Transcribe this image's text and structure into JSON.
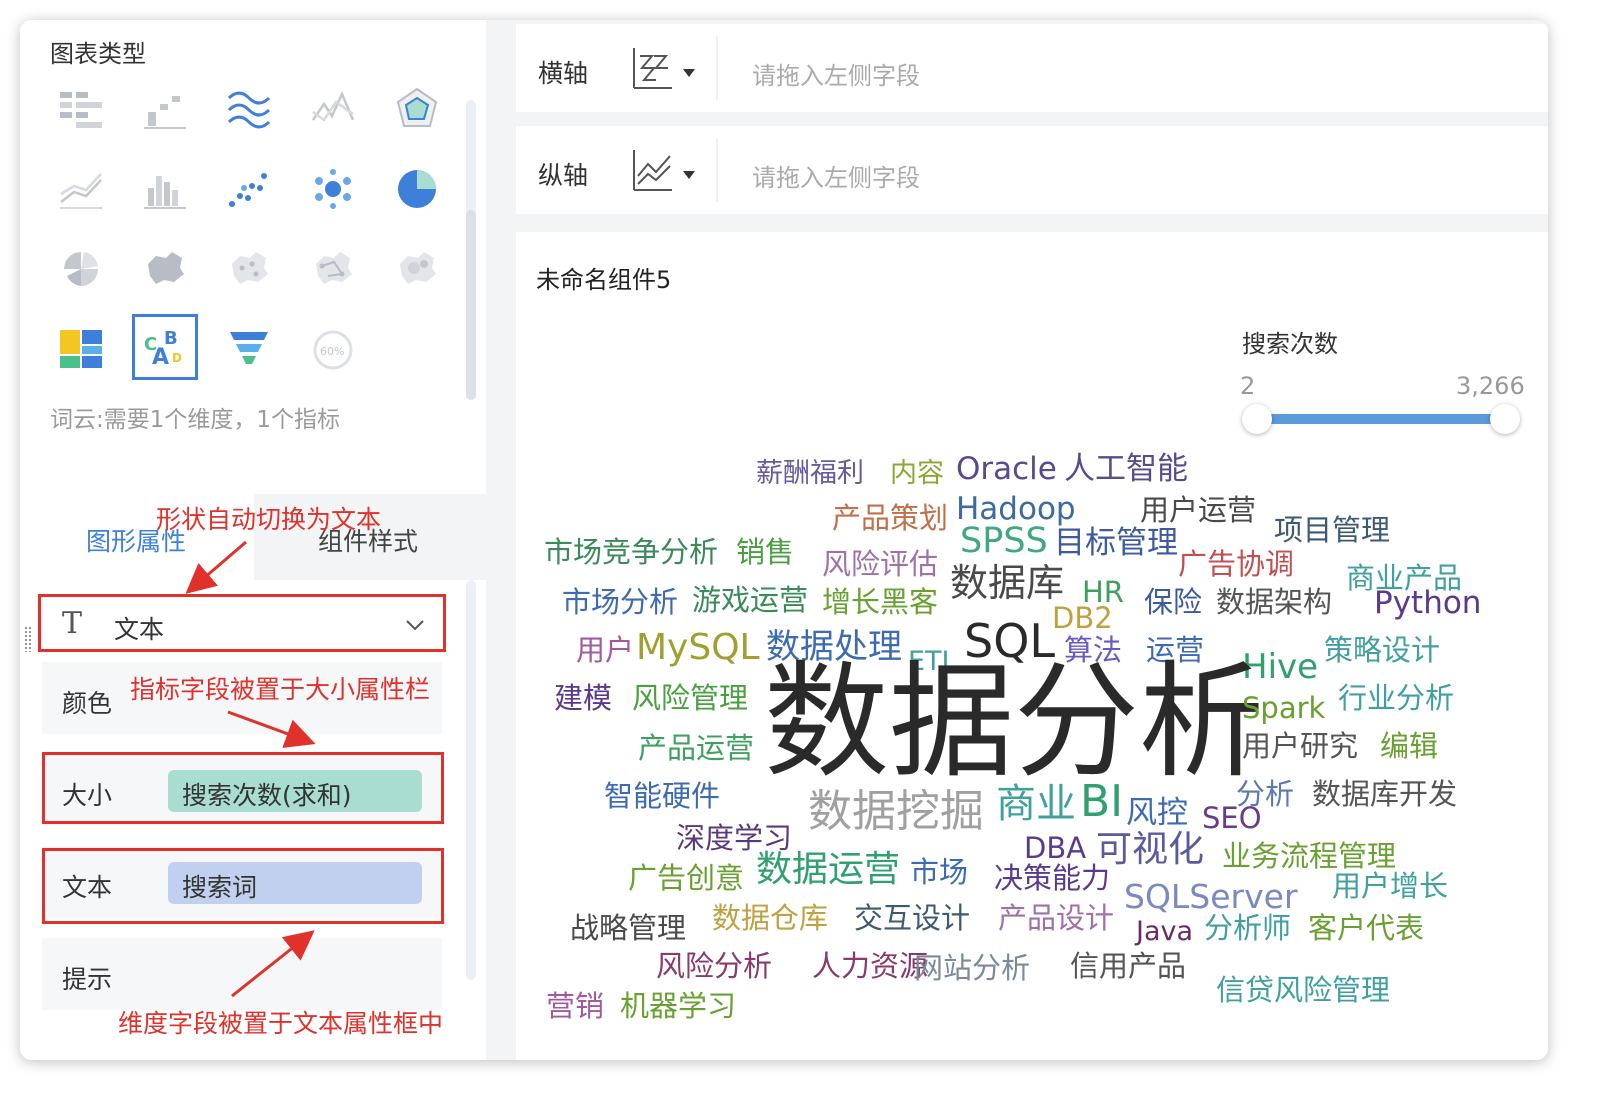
{
  "left_panel": {
    "chart_types_title": "图表类型",
    "selected_type": "word-cloud",
    "hint": "词云:需要1个维度，1个指标",
    "tabs": {
      "graphic": "图形属性",
      "style": "组件样式"
    },
    "shape_select": {
      "value": "文本"
    },
    "props": {
      "color_label": "颜色",
      "size_label": "大小",
      "size_field": "搜索次数(求和)",
      "text_label": "文本",
      "text_field": "搜索词",
      "tip_label": "提示"
    },
    "annotations": {
      "shape_note": "形状自动切换为文本",
      "size_note": "指标字段被置于大小属性栏",
      "text_note": "维度字段被置于文本属性框中"
    }
  },
  "axes": {
    "x_label": "横轴",
    "y_label": "纵轴",
    "placeholder": "请拖入左侧字段"
  },
  "widget": {
    "title": "未命名组件5",
    "legend_title": "搜索次数",
    "legend_min": "2",
    "legend_max": "3,266"
  },
  "chart_data": {
    "type": "word-cloud",
    "words": [
      {
        "text": "薪酬福利",
        "color": "#6a5a9c"
      },
      {
        "text": "内容",
        "color": "#8aa832"
      },
      {
        "text": "Oracle",
        "color": "#5a4a8c"
      },
      {
        "text": "人工智能",
        "color": "#5a4a8c"
      },
      {
        "text": "产品策划",
        "color": "#c0704a"
      },
      {
        "text": "Hadoop",
        "color": "#3d6aa0"
      },
      {
        "text": "用户运营",
        "color": "#4a4a4a"
      },
      {
        "text": "项目管理",
        "color": "#3d5a70"
      },
      {
        "text": "市场竞争分析",
        "color": "#3a8a5a"
      },
      {
        "text": "销售",
        "color": "#4aa040"
      },
      {
        "text": "风险评估",
        "color": "#a070a8"
      },
      {
        "text": "SPSS",
        "color": "#40a880"
      },
      {
        "text": "目标管理",
        "color": "#3d5a9c"
      },
      {
        "text": "广告协调",
        "color": "#c05050"
      },
      {
        "text": "商业产品",
        "color": "#40a0a0"
      },
      {
        "text": "市场分析",
        "color": "#3d6ab0"
      },
      {
        "text": "游戏运营",
        "color": "#3a8a5a"
      },
      {
        "text": "增长黑客",
        "color": "#6aa030"
      },
      {
        "text": "数据库",
        "color": "#4a4a4a"
      },
      {
        "text": "HR",
        "color": "#40a060"
      },
      {
        "text": "保险",
        "color": "#3d5a9c"
      },
      {
        "text": "数据架构",
        "color": "#555555"
      },
      {
        "text": "Python",
        "color": "#5a3a8c"
      },
      {
        "text": "DB2",
        "color": "#c0a040"
      },
      {
        "text": "SQL",
        "color": "#2a2a2a"
      },
      {
        "text": "用户",
        "color": "#a05aa0"
      },
      {
        "text": "MySQL",
        "color": "#a0a030"
      },
      {
        "text": "数据处理",
        "color": "#3d6ab0"
      },
      {
        "text": "ETL",
        "color": "#40a0a0"
      },
      {
        "text": "算法",
        "color": "#6a5ac0"
      },
      {
        "text": "运营",
        "color": "#3d6ab0"
      },
      {
        "text": "策略设计",
        "color": "#40a0a0"
      },
      {
        "text": "Hive",
        "color": "#30a070"
      },
      {
        "text": "建模",
        "color": "#5a3a8c"
      },
      {
        "text": "风险管理",
        "color": "#4aa040"
      },
      {
        "text": "数据分析",
        "color": "#2a2a2a"
      },
      {
        "text": "Spark",
        "color": "#6aa030"
      },
      {
        "text": "行业分析",
        "color": "#40a0a0"
      },
      {
        "text": "产品运营",
        "color": "#40a060"
      },
      {
        "text": "用户研究",
        "color": "#555555"
      },
      {
        "text": "编辑",
        "color": "#6aa030"
      },
      {
        "text": "分析",
        "color": "#5a7ab0"
      },
      {
        "text": "数据库开发",
        "color": "#555555"
      },
      {
        "text": "智能硬件",
        "color": "#3d6ab0"
      },
      {
        "text": "数据挖掘",
        "color": "#a0a0a0"
      },
      {
        "text": "商业",
        "color": "#40a0a0"
      },
      {
        "text": "BI",
        "color": "#30a070"
      },
      {
        "text": "风控",
        "color": "#3d6ab0"
      },
      {
        "text": "SEO",
        "color": "#6a3a8c"
      },
      {
        "text": "深度学习",
        "color": "#5a3a7c"
      },
      {
        "text": "DBA",
        "color": "#5a3a8c"
      },
      {
        "text": "可视化",
        "color": "#5a5a9c"
      },
      {
        "text": "业务流程管理",
        "color": "#6aa030"
      },
      {
        "text": "广告创意",
        "color": "#6aa030"
      },
      {
        "text": "数据运营",
        "color": "#30a070"
      },
      {
        "text": "市场",
        "color": "#3d6ab0"
      },
      {
        "text": "决策能力",
        "color": "#5a3a8c"
      },
      {
        "text": "SQLServer",
        "color": "#7a8ac0"
      },
      {
        "text": "用户增长",
        "color": "#40a0a0"
      },
      {
        "text": "战略管理",
        "color": "#4a4a4a"
      },
      {
        "text": "数据仓库",
        "color": "#c0a040"
      },
      {
        "text": "交互设计",
        "color": "#3d5a70"
      },
      {
        "text": "产品设计",
        "color": "#a070a8"
      },
      {
        "text": "Java",
        "color": "#6a2a6a"
      },
      {
        "text": "分析师",
        "color": "#40a0a0"
      },
      {
        "text": "客户代表",
        "color": "#6aa030"
      },
      {
        "text": "风险分析",
        "color": "#8a3a6a"
      },
      {
        "text": "人力资源",
        "color": "#8a3a6a"
      },
      {
        "text": "网站分析",
        "color": "#7a8a9c"
      },
      {
        "text": "信用产品",
        "color": "#555555"
      },
      {
        "text": "信贷风险管理",
        "color": "#40a0a0"
      },
      {
        "text": "营销",
        "color": "#a05aa0"
      },
      {
        "text": "机器学习",
        "color": "#6aa030"
      }
    ]
  }
}
